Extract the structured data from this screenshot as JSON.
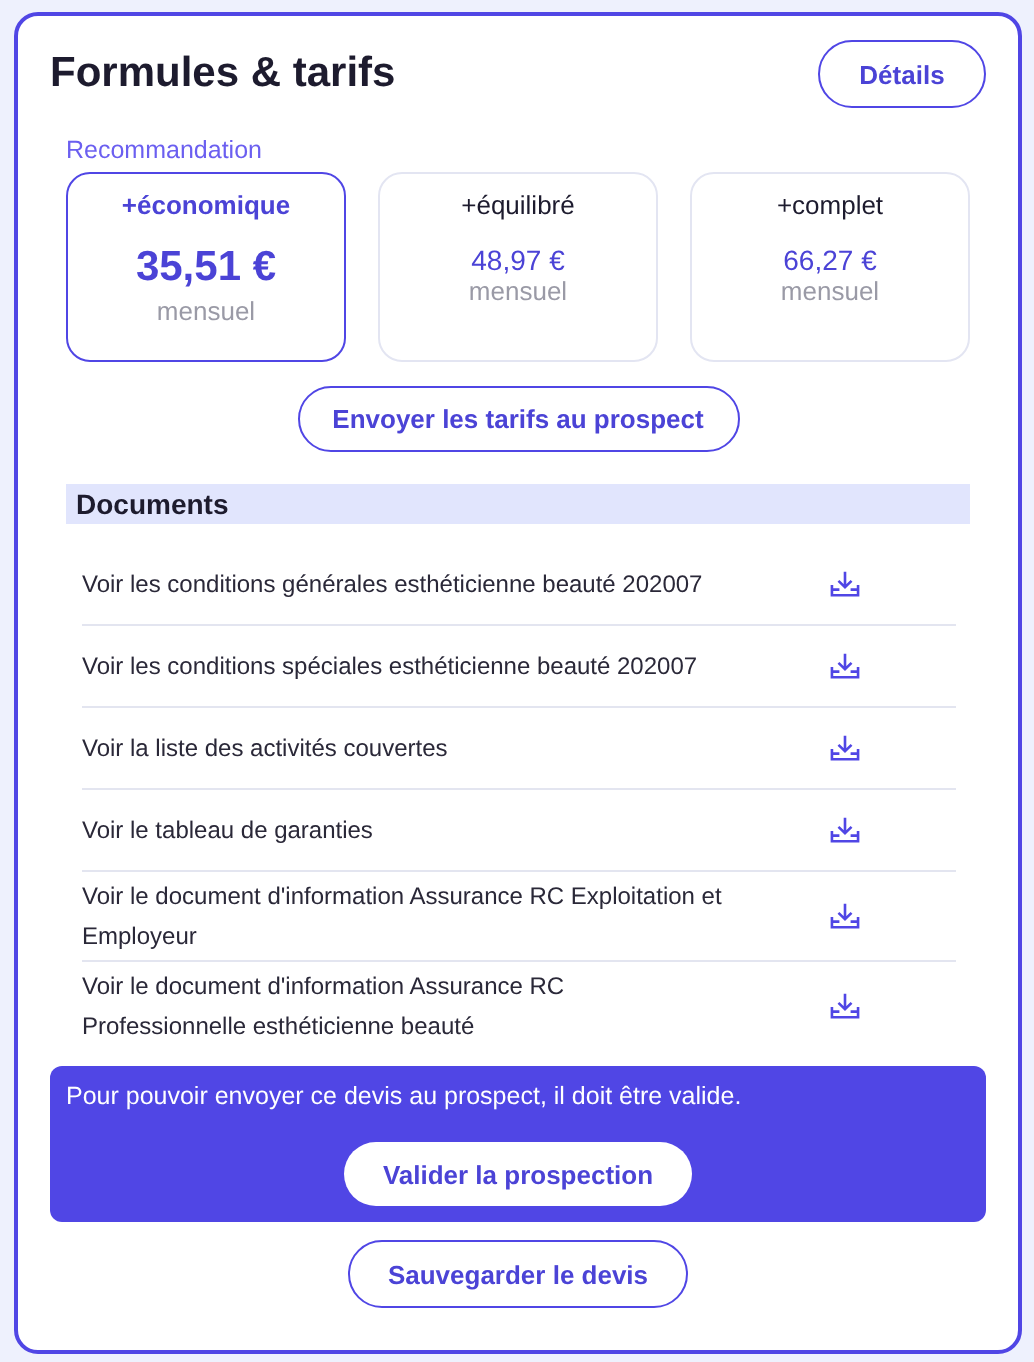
{
  "title": "Formules & tarifs",
  "details_button": "Détails",
  "recommendation_label": "Recommandation",
  "plans": [
    {
      "name": "+économique",
      "price": "35,51 €",
      "period": "mensuel",
      "selected": true
    },
    {
      "name": "+équilibré",
      "price": "48,97 €",
      "period": "mensuel",
      "selected": false
    },
    {
      "name": "+complet",
      "price": "66,27 €",
      "period": "mensuel",
      "selected": false
    }
  ],
  "send_button": "Envoyer les tarifs au prospect",
  "documents": {
    "heading": "Documents",
    "items": [
      {
        "label": "Voir les conditions générales esthéticienne beauté 202007"
      },
      {
        "label": "Voir les conditions spéciales esthéticienne beauté 202007"
      },
      {
        "label": "Voir la liste des activités couvertes"
      },
      {
        "label": "Voir le tableau de garanties"
      },
      {
        "label": "Voir le document d'information Assurance RC Exploitation et Employeur"
      },
      {
        "label": "Voir le document d'information Assurance RC Professionnelle esthéticienne beauté"
      }
    ]
  },
  "notice": {
    "text": "Pour pouvoir envoyer ce devis au prospect, il doit être valide.",
    "button": "Valider la prospection"
  },
  "save_button": "Sauvegarder le devis"
}
